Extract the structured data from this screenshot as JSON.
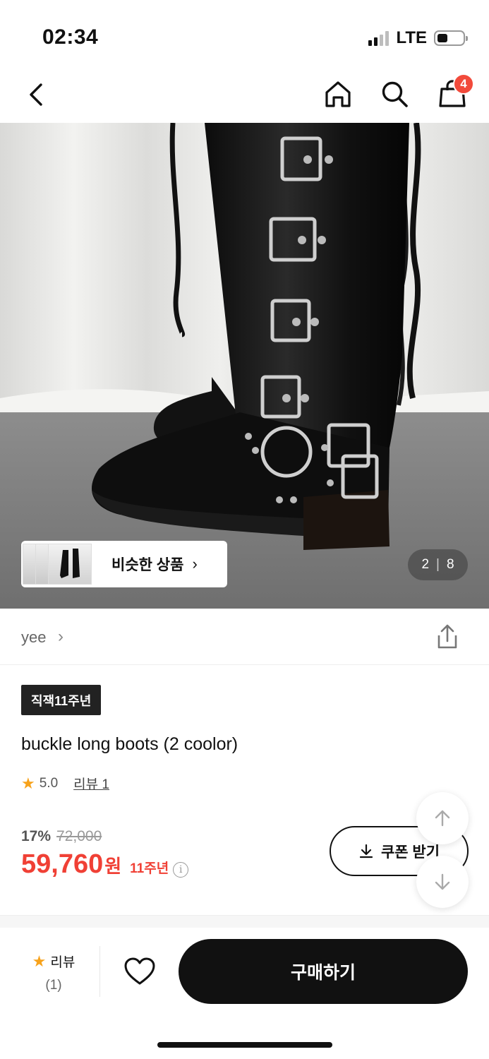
{
  "status": {
    "time": "02:34",
    "network": "LTE"
  },
  "nav": {
    "cart_count": "4"
  },
  "gallery": {
    "current": "2",
    "separator": "|",
    "total": "8"
  },
  "similar": {
    "label": "비슷한 상품",
    "chevron": "›"
  },
  "brand": {
    "name": "yee",
    "chevron": "›"
  },
  "product": {
    "badge": "직잭11주년",
    "title": "buckle long boots (2 coolor)",
    "rating": "5.0",
    "review_link": "리뷰 1",
    "discount_rate": "17%",
    "original_price": "72,000",
    "sale_price": "59,760",
    "currency": "원",
    "anniversary_label": "11주년",
    "info_glyph": "i"
  },
  "coupon": {
    "label": "쿠폰 받기"
  },
  "bottom": {
    "review_label": "리뷰",
    "review_count": "(1)",
    "buy_label": "구매하기"
  },
  "icons": {
    "back": "back-arrow-icon",
    "home": "home-icon",
    "search": "search-icon",
    "cart": "shopping-bag-icon",
    "share": "share-icon",
    "star": "star-icon",
    "heart": "heart-icon",
    "download": "download-icon",
    "arrow_up": "arrow-up-icon",
    "arrow_down": "arrow-down-icon"
  },
  "colors": {
    "accent_red": "#f04035",
    "badge_red": "#f24a3b",
    "star": "#f7a21b",
    "primary_button": "#111111"
  }
}
